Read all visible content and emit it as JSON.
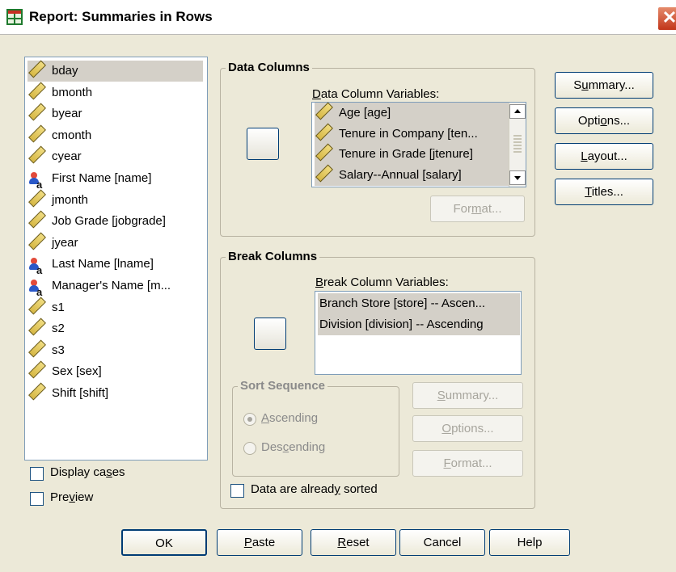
{
  "window": {
    "title": "Report: Summaries in Rows",
    "close_glyph": "✕"
  },
  "source_list": {
    "items": [
      {
        "label": "bday",
        "icon": "ruler-icon"
      },
      {
        "label": "bmonth",
        "icon": "ruler-icon"
      },
      {
        "label": "byear",
        "icon": "ruler-icon"
      },
      {
        "label": "cmonth",
        "icon": "ruler-icon"
      },
      {
        "label": "cyear",
        "icon": "ruler-icon"
      },
      {
        "label": "First Name [name]",
        "icon": "nominal-string-icon"
      },
      {
        "label": "jmonth",
        "icon": "ruler-icon"
      },
      {
        "label": "Job Grade [jobgrade]",
        "icon": "ruler-icon"
      },
      {
        "label": "jyear",
        "icon": "ruler-icon"
      },
      {
        "label": "Last Name [lname]",
        "icon": "nominal-string-icon"
      },
      {
        "label": "Manager's Name [m...",
        "icon": "nominal-string-icon"
      },
      {
        "label": "s1",
        "icon": "ruler-icon"
      },
      {
        "label": "s2",
        "icon": "ruler-icon"
      },
      {
        "label": "s3",
        "icon": "ruler-icon"
      },
      {
        "label": "Sex [sex]",
        "icon": "ruler-icon"
      },
      {
        "label": "Shift [shift]",
        "icon": "ruler-icon"
      }
    ],
    "selected_index": 0
  },
  "data_columns": {
    "group_label": "Data Columns",
    "list_label_pre": "",
    "list_label_u": "D",
    "list_label_post": "ata Column Variables:",
    "items": [
      "Age [age]",
      "Tenure in Company [ten...",
      "Tenure in Grade [jtenure]",
      "Salary--Annual [salary]"
    ],
    "format_pre": "For",
    "format_u": "m",
    "format_post": "at..."
  },
  "break_columns": {
    "group_label": "Break Columns",
    "list_label_u": "B",
    "list_label_post": "reak Column Variables:",
    "items": [
      "Branch Store [store] -- Ascen...",
      "Division [division] -- Ascending"
    ]
  },
  "sort_sequence": {
    "group_label": "Sort Sequence",
    "ascending_u": "A",
    "ascending_post": "scending",
    "descending_pre": "Des",
    "descending_u": "c",
    "descending_post": "ending",
    "selected": "Ascending"
  },
  "break_buttons": {
    "summary_u": "S",
    "summary_post": "ummary...",
    "options_pre": "",
    "options_u": "O",
    "options_post": "ptions...",
    "format_u": "F",
    "format_post": "ormat..."
  },
  "right_buttons": {
    "summary_pre": "S",
    "summary_u": "u",
    "summary_post": "mmary...",
    "options_pre": "Opti",
    "options_u": "o",
    "options_post": "ns...",
    "layout_u": "L",
    "layout_post": "ayout...",
    "titles_u": "T",
    "titles_post": "itles..."
  },
  "checkboxes": {
    "display_cases_pre": "Display ca",
    "display_cases_u": "s",
    "display_cases_post": "es",
    "preview_pre": "Pre",
    "preview_u": "v",
    "preview_post": "iew",
    "already_sorted_pre": "Data are alread",
    "already_sorted_u": "y",
    "already_sorted_post": " sorted"
  },
  "footer": {
    "ok": "OK",
    "paste_u": "P",
    "paste_post": "aste",
    "reset_u": "R",
    "reset_post": "eset",
    "cancel": "Cancel",
    "help": "Help"
  },
  "colors": {
    "arrow_blue": "#2c4fa3",
    "selection_gray": "#d4d0c8",
    "dialog_bg": "#ece9d8"
  }
}
